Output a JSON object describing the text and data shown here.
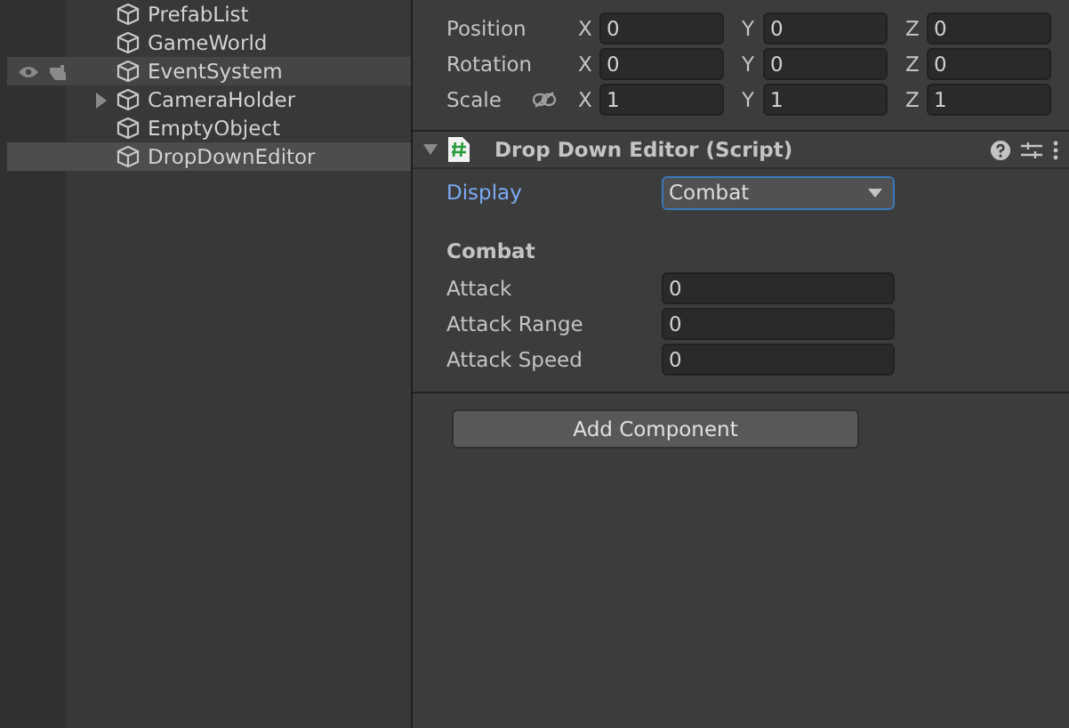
{
  "hierarchy": {
    "items": [
      {
        "name": "PrefabList",
        "kind": "leaf",
        "selected": false,
        "hovered": false
      },
      {
        "name": "GameWorld",
        "kind": "leaf",
        "selected": false,
        "hovered": false
      },
      {
        "name": "EventSystem",
        "kind": "leaf",
        "selected": false,
        "hovered": true
      },
      {
        "name": "CameraHolder",
        "kind": "closed_group",
        "selected": false,
        "hovered": false
      },
      {
        "name": "EmptyObject",
        "kind": "leaf",
        "selected": false,
        "hovered": false
      },
      {
        "name": "DropDownEditor",
        "kind": "leaf",
        "selected": true,
        "hovered": false
      }
    ]
  },
  "inspector": {
    "transform": [
      {
        "label": "Position",
        "kind": "vector",
        "fields": [
          {
            "axis": "X",
            "value": "0"
          },
          {
            "axis": "Y",
            "value": "0"
          },
          {
            "axis": "Z",
            "value": "0"
          }
        ]
      },
      {
        "label": "Rotation",
        "kind": "vector",
        "fields": [
          {
            "axis": "X",
            "value": "0"
          },
          {
            "axis": "Y",
            "value": "0"
          },
          {
            "axis": "Z",
            "value": "0"
          }
        ]
      },
      {
        "label": "Scale",
        "kind": "scale",
        "fields": [
          {
            "axis": "X",
            "value": "1"
          },
          {
            "axis": "Y",
            "value": "1"
          },
          {
            "axis": "Z",
            "value": "1"
          }
        ]
      }
    ],
    "component": {
      "title": "Drop Down Editor (Script)",
      "expanded": true,
      "display": {
        "label": "Display",
        "value": "Combat",
        "focused": true
      },
      "section": "Combat",
      "fields": [
        {
          "label": "Attack",
          "value": "0"
        },
        {
          "label": "Attack Range",
          "value": "0"
        },
        {
          "label": "Attack Speed",
          "value": "0"
        }
      ]
    },
    "add_button": "Add Component"
  }
}
